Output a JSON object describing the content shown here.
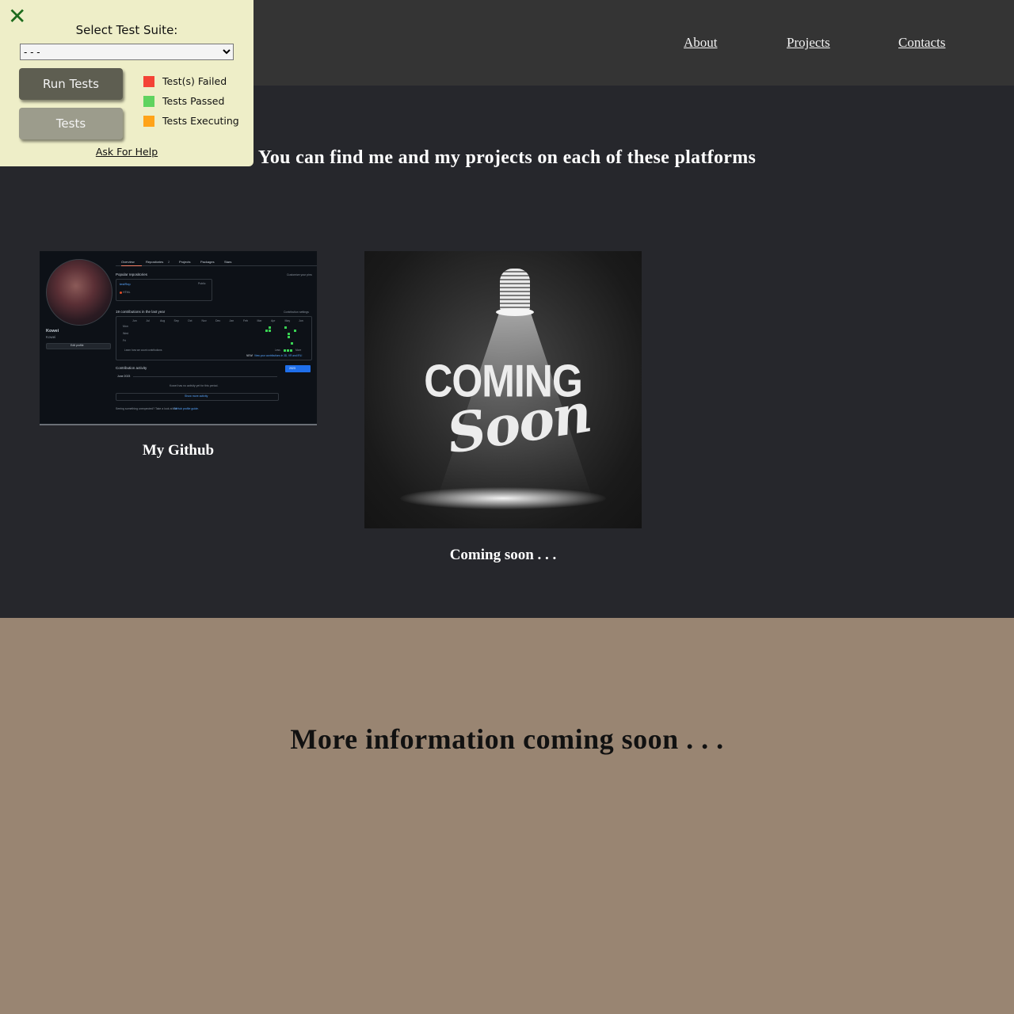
{
  "nav": {
    "about": "About",
    "projects": "Projects",
    "contacts": "Contacts"
  },
  "projects_section": {
    "heading": "You can find me and my projects on each of these platforms",
    "cards": [
      {
        "caption": "My Github",
        "screenshot": {
          "tabs": [
            "Overview",
            "Repositories",
            "Projects",
            "Packages",
            "Stars"
          ],
          "repositories_badge": "2",
          "popular_label": "Popular repositories",
          "customize_label": "Customize your pins",
          "repo_name": "testRep",
          "repo_visibility": "Public",
          "repo_language": "HTML",
          "contributions_label": "19 contributions in the last year",
          "contribution_settings": "Contribution settings",
          "months": [
            "Jun",
            "Jul",
            "Aug",
            "Sep",
            "Oct",
            "Nov",
            "Dec",
            "Jan",
            "Feb",
            "Mar",
            "Apr",
            "May",
            "Jun"
          ],
          "days": [
            "Mon",
            "Wed",
            "Fri"
          ],
          "learn_label": "Learn how we count contributions",
          "less_label": "Less",
          "more_label": "More",
          "new_label": "NEW!",
          "view_label": "View your contributions in 3D, VR and IRL!",
          "activity_label": "Contribution activity",
          "year": "2023",
          "month_label": "June 2023",
          "no_activity": "Kowei has no activity yet for this period.",
          "show_more": "Show more activity",
          "profile_name": "Kowei",
          "profile_login": "Kowei",
          "edit_profile": "Edit profile",
          "footer_text": "Seeing something unexpected? Take a look at the",
          "footer_link": "GitHub profile guide."
        }
      },
      {
        "caption": "Coming soon . . .",
        "image_text_top": "COMING",
        "image_text_script": "Soon"
      }
    ]
  },
  "bottom": {
    "title": "More information coming soon . . ."
  },
  "test_panel": {
    "select_label": "Select Test Suite:",
    "select_value": "- - -",
    "run_button": "Run Tests",
    "tests_button": "Tests",
    "legend": [
      {
        "label": "Test(s) Failed",
        "color": "#f44336"
      },
      {
        "label": "Tests Passed",
        "color": "#5fd35f"
      },
      {
        "label": "Tests Executing",
        "color": "#ffa319"
      }
    ],
    "help_link": "Ask For Help"
  },
  "colors": {
    "header_bg": "#343434",
    "page_bg": "#26272c",
    "bottom_bg": "#998572",
    "panel_bg": "#eeeec8",
    "close_icon": "#1d6b1d"
  }
}
